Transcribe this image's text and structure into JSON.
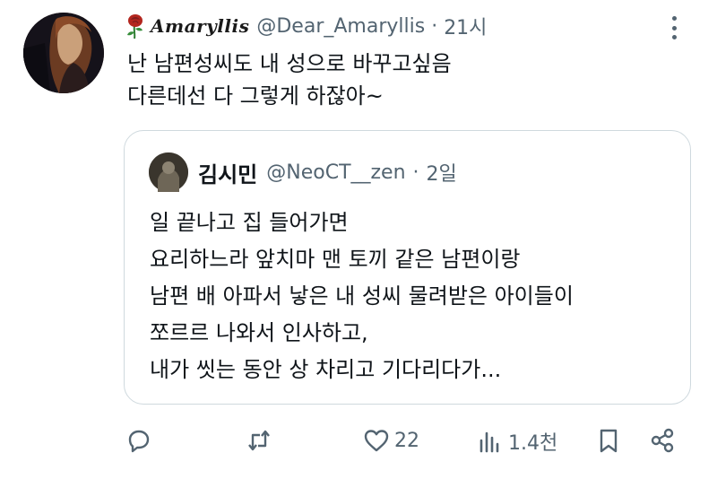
{
  "tweet": {
    "display_name": "Amaryllis",
    "handle": "@Dear_Amaryllis",
    "separator": "·",
    "time": "21시",
    "text": "난 남편성씨도 내 성으로 바꾸고싶음\n다른데선 다 그렇게 하잖아~"
  },
  "quote": {
    "name": "김시민",
    "handle": "@NeoCT__zen",
    "separator": "·",
    "time": "2일",
    "text": "일 끝나고 집 들어가면\n요리하느라 앞치마 맨 토끼 같은 남편이랑\n남편 배 아파서 낳은 내 성씨 물려받은 아이들이\n쪼르르 나와서 인사하고,\n내가 씻는 동안 상 차리고 기다리다가..."
  },
  "actions": {
    "like_count": "22",
    "views_count": "1.4천"
  },
  "icons": {
    "name_emblem": "rose-icon",
    "reply": "reply-icon",
    "retweet": "retweet-icon",
    "like": "heart-icon",
    "views": "views-icon",
    "bookmark": "bookmark-icon",
    "share": "share-icon",
    "more": "more-icon"
  },
  "colors": {
    "secondary_text": "#536471",
    "border": "#cfd9de",
    "rose_red": "#b3261e"
  }
}
